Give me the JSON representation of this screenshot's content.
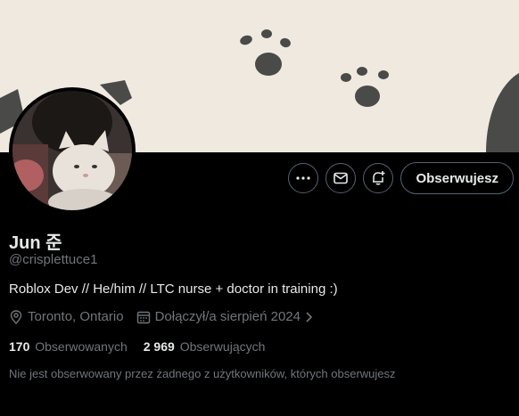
{
  "profile": {
    "display_name": "Jun 준",
    "handle": "@crisplettuce1",
    "bio": "Roblox Dev // He/him // LTC nurse + doctor in training :)",
    "location": "Toronto, Ontario",
    "joined": "Dołączył/a sierpień 2024"
  },
  "actions": {
    "follow_label": "Obserwujesz",
    "more_icon": "more-icon",
    "message_icon": "mail-icon",
    "notify_icon": "bell-plus-icon"
  },
  "stats": {
    "following_count": "170",
    "following_label": "Obserwowanych",
    "followers_count": "2 969",
    "followers_label": "Obserwujących"
  },
  "mutual_text": "Nie jest obserwowany przez żadnego z użytkowników, których obserwujesz",
  "colors": {
    "background": "#000000",
    "banner": "#efe9e0",
    "paw": "#4a4a48",
    "muted_text": "#71767b",
    "primary_text": "#e7e9ea",
    "border": "#536471"
  }
}
